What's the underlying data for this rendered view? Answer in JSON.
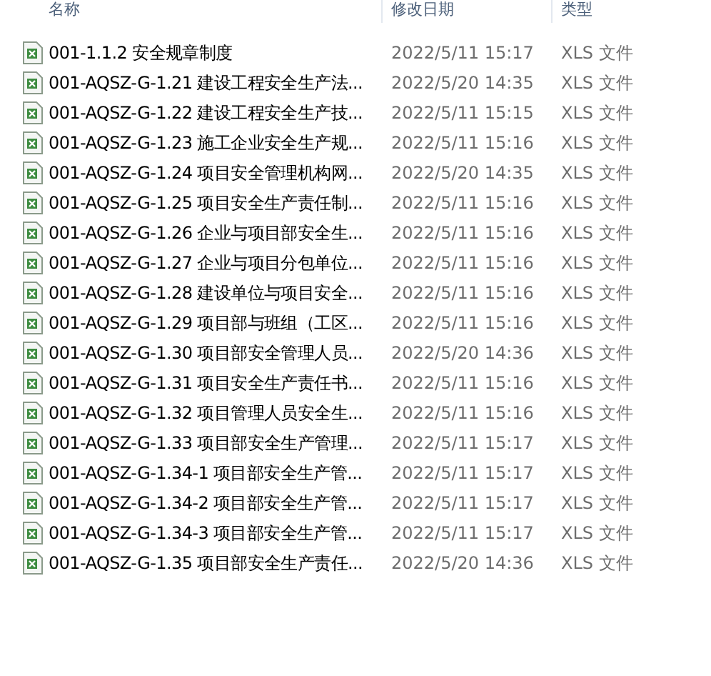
{
  "columns": [
    "名称",
    "修改日期",
    "类型"
  ],
  "files": [
    {
      "name": "001-1.1.2 安全规章制度",
      "modified": "2022/5/11 15:17",
      "type": "XLS 文件"
    },
    {
      "name": "001-AQSZ-G-1.21 建设工程安全生产法...",
      "modified": "2022/5/20 14:35",
      "type": "XLS 文件"
    },
    {
      "name": "001-AQSZ-G-1.22 建设工程安全生产技...",
      "modified": "2022/5/11 15:15",
      "type": "XLS 文件"
    },
    {
      "name": "001-AQSZ-G-1.23 施工企业安全生产规...",
      "modified": "2022/5/11 15:16",
      "type": "XLS 文件"
    },
    {
      "name": "001-AQSZ-G-1.24 项目安全管理机构网...",
      "modified": "2022/5/20 14:35",
      "type": "XLS 文件"
    },
    {
      "name": "001-AQSZ-G-1.25 项目安全生产责任制...",
      "modified": "2022/5/11 15:16",
      "type": "XLS 文件"
    },
    {
      "name": "001-AQSZ-G-1.26 企业与项目部安全生...",
      "modified": "2022/5/11 15:16",
      "type": "XLS 文件"
    },
    {
      "name": "001-AQSZ-G-1.27 企业与项目分包单位...",
      "modified": "2022/5/11 15:16",
      "type": "XLS 文件"
    },
    {
      "name": "001-AQSZ-G-1.28 建设单位与项目安全...",
      "modified": "2022/5/11 15:16",
      "type": "XLS 文件"
    },
    {
      "name": "001-AQSZ-G-1.29 项目部与班组（工区...",
      "modified": "2022/5/11 15:16",
      "type": "XLS 文件"
    },
    {
      "name": "001-AQSZ-G-1.30 项目部安全管理人员...",
      "modified": "2022/5/20 14:36",
      "type": "XLS 文件"
    },
    {
      "name": "001-AQSZ-G-1.31 项目安全生产责任书...",
      "modified": "2022/5/11 15:16",
      "type": "XLS 文件"
    },
    {
      "name": "001-AQSZ-G-1.32 项目管理人员安全生...",
      "modified": "2022/5/11 15:16",
      "type": "XLS 文件"
    },
    {
      "name": "001-AQSZ-G-1.33 项目部安全生产管理...",
      "modified": "2022/5/11 15:17",
      "type": "XLS 文件"
    },
    {
      "name": "001-AQSZ-G-1.34-1 项目部安全生产管...",
      "modified": "2022/5/11 15:17",
      "type": "XLS 文件"
    },
    {
      "name": "001-AQSZ-G-1.34-2 项目部安全生产管...",
      "modified": "2022/5/11 15:17",
      "type": "XLS 文件"
    },
    {
      "name": "001-AQSZ-G-1.34-3 项目部安全生产管...",
      "modified": "2022/5/11 15:17",
      "type": "XLS 文件"
    },
    {
      "name": "001-AQSZ-G-1.35 项目部安全生产责任...",
      "modified": "2022/5/20 14:36",
      "type": "XLS 文件"
    }
  ]
}
